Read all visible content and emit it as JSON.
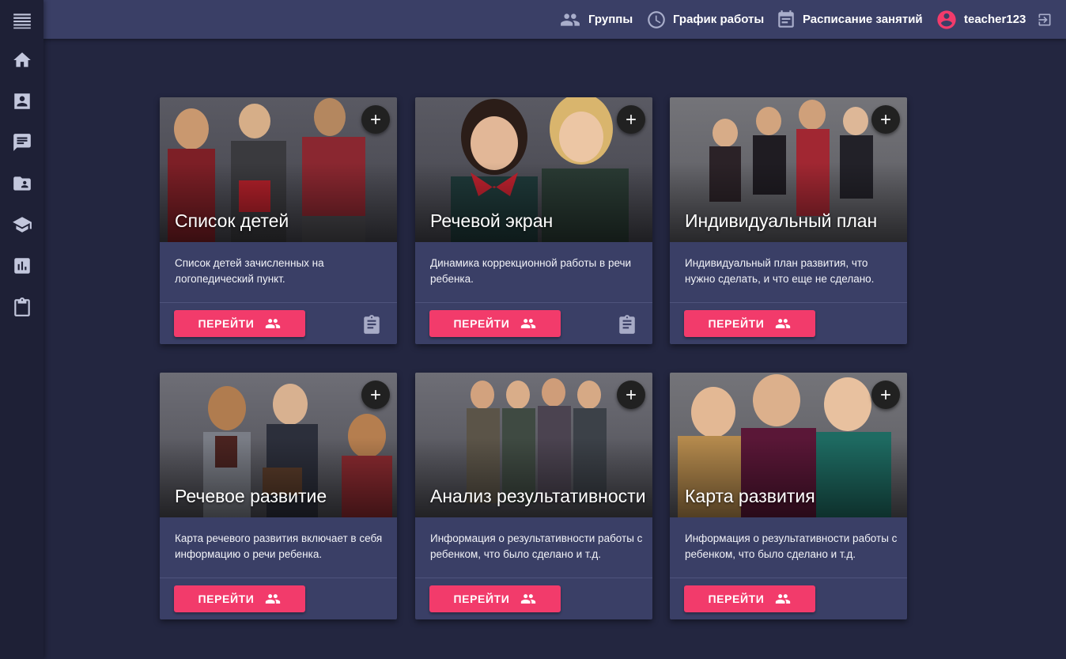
{
  "topbar": {
    "groups_label": "Группы",
    "schedule_label": "График работы",
    "timetable_label": "Расписание занятий",
    "username": "teacher123"
  },
  "sidebar": {
    "items": [
      "menu",
      "home",
      "contact",
      "chat",
      "folder-user",
      "school",
      "chart",
      "clipboard"
    ]
  },
  "cards": [
    {
      "title": "Список детей",
      "description": "Список детей зачисленных на логопедический пункт.",
      "button": "ПЕРЕЙТИ",
      "image": "children-plaid-outfits-photo"
    },
    {
      "title": "Речевой экран",
      "description": "Динамика коррекционной работы в речи ребенка.",
      "button": "ПЕРЕЙТИ",
      "image": "two-girls-smiling-photo"
    },
    {
      "title": "Индивидуальный план",
      "description": "Индивидуальный план развития, что нужно сделать, и что еще не сделано.",
      "button": "ПЕРЕЙТИ",
      "image": "girls-in-dresses-jumping-photo"
    },
    {
      "title": "Речевое развитие",
      "description": "Карта речевого развития включает в себя информацию о речи ребенка.",
      "button": "ПЕРЕЙТИ",
      "image": "schoolchildren-with-bags-photo"
    },
    {
      "title": "Анализ результативности",
      "description": "Информация о результативности работы с ребенком, что было сделано и т.д.",
      "button": "ПЕРЕЙТИ",
      "image": "boys-in-scarves-photo"
    },
    {
      "title": "Карта развития",
      "description": "Информация о результативности работы с ребенком, что было сделано и т.д.",
      "button": "ПЕРЕЙТИ",
      "image": "laughing-kids-tshirts-photo"
    }
  ],
  "colors": {
    "background": "#232640",
    "sidebar": "#1e2036",
    "topbar": "#3a3f66",
    "card": "#3a3f66",
    "accent": "#f23b6b",
    "icon": "#a9aecb"
  }
}
